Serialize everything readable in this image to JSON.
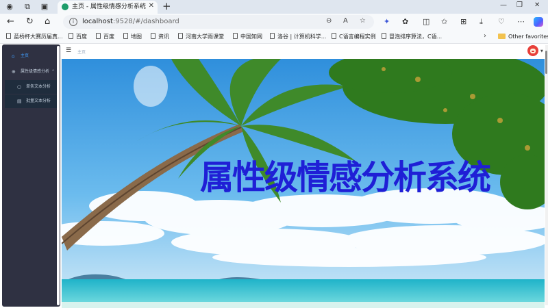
{
  "browser": {
    "tab_title": "主页 - 属性级情感分析系统",
    "url_host": "localhost",
    "url_rest": ":9528/#/dashboard",
    "bookmarks": [
      "蓝桥杯大赛历届真...",
      "百度",
      "百度",
      "地图",
      "资讯",
      "河南大学雨课堂",
      "中国知网",
      "洛谷 | 计算机科学...",
      "C语言编程实例",
      "冒泡排序算法，C语..."
    ],
    "other_favorites": "Other favorites"
  },
  "sidebar": {
    "home": "主页",
    "group": "属性级情感分析",
    "sub_items": [
      "单条文本分析",
      "批量文本分析"
    ]
  },
  "topnav": {
    "breadcrumb": "主页"
  },
  "hero": {
    "title": "属性级情感分析系统",
    "colors": {
      "title": "#1f1fd6",
      "sky": "#4aa8e8",
      "sea": "#35c6d6"
    }
  },
  "icons": {
    "sidebar_home": "home-icon",
    "sidebar_group": "plus-circle-icon",
    "sidebar_single": "search-icon",
    "sidebar_batch": "document-icon"
  }
}
